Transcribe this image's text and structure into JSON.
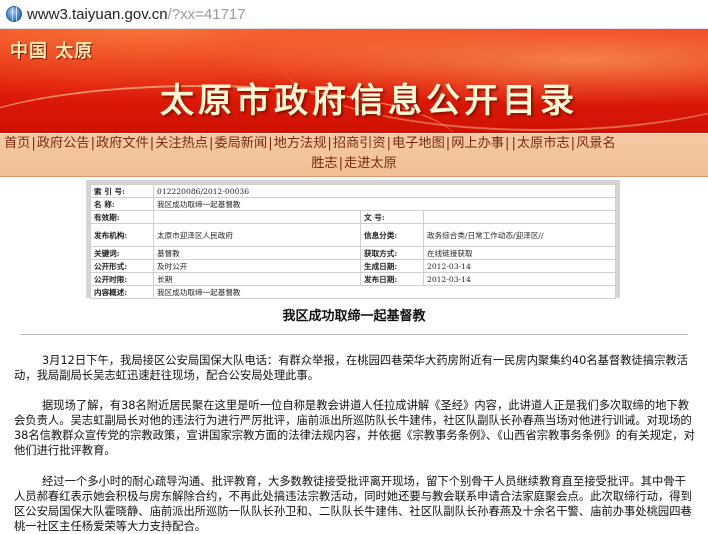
{
  "address_bar": {
    "url_main": "www3.taiyuan.gov.cn",
    "url_query": "/?xx=41717"
  },
  "banner": {
    "logo": "中国 太原",
    "title": "太原市政府信息公开目录"
  },
  "nav": {
    "line1": [
      "首页",
      "政府公告",
      "政府文件",
      "关注热点",
      "委局新闻",
      "地方法规",
      "招商引资",
      "电子地图",
      "网上办事",
      "太原市志",
      "风景名"
    ],
    "line2": [
      "胜志",
      "走进太原"
    ]
  },
  "meta": {
    "index_label": "索 引 号:",
    "index_value": "012220086/2012-00036",
    "name_label": "名     称:",
    "name_value": "我区成功取缔一起基督教",
    "docno_label": "有效期:",
    "docno_value": "",
    "wenhao_label": "文     号:",
    "wenhao_value": "",
    "publisher_label": "发布机构:",
    "publisher_value": "太原市迎泽区人民政府",
    "category_label": "信息分类:",
    "category_value": "政务综合类/日常工作动态/迎泽区//",
    "keywords_label": "关键词:",
    "keywords_value": "基督教",
    "method_label": "获取方式:",
    "method_value": "在线链接获取",
    "form_label": "公开形式:",
    "form_value": "及时公开",
    "created_label": "生成日期:",
    "created_value": "2012-03-14",
    "period_label": "公开时限:",
    "period_value": "长期",
    "published_label": "发布日期:",
    "published_value": "2012-03-14",
    "summary_label": "内容概述:",
    "summary_value": "我区成功取缔一起基督教"
  },
  "article": {
    "title": "我区成功取缔一起基督教",
    "p1": "3月12日下午，我局接区公安局国保大队电话：有群众举报，在桃园四巷荣华大药房附近有一民房内聚集约40名基督教徒搞宗教活动，我局副局长吴志虹迅速赶往现场，配合公安局处理此事。",
    "p2": "据现场了解，有38名附近居民聚在这里是听一位自称是教会讲道人任拉成讲解《圣经》内容，此讲道人正是我们多次取缔的地下教会负责人。吴志虹副局长对他的违法行为进行严厉批评，庙前派出所巡防队长牛建伟，社区队副队长孙春燕当场对他进行训诫。对现场的38名信教群众宣传党的宗教政策，宣讲国家宗教方面的法律法规内容，并依据《宗教事务条例》、《山西省宗教事务条例》的有关规定，对他们进行批评教育。",
    "p3": "经过一个多小时的耐心疏导沟通、批评教育，大多数教徒接受批评离开现场，留下个别骨干人员继续教育直至接受批评。其中骨干人员郝春红表示她会积极与房东解除合约，不再此处搞违法宗教活动，同时她还要与教会联系申请合法家庭聚会点。此次取缔行动，得到区公安局国保大队霍晓静、庙前派出所巡防一队队长孙卫和、二队队长牛建伟、社区队副队长孙春燕及十余名干警、庙前办事处桃园四巷桃一社区主任杨爱荣等大力支持配合。"
  }
}
